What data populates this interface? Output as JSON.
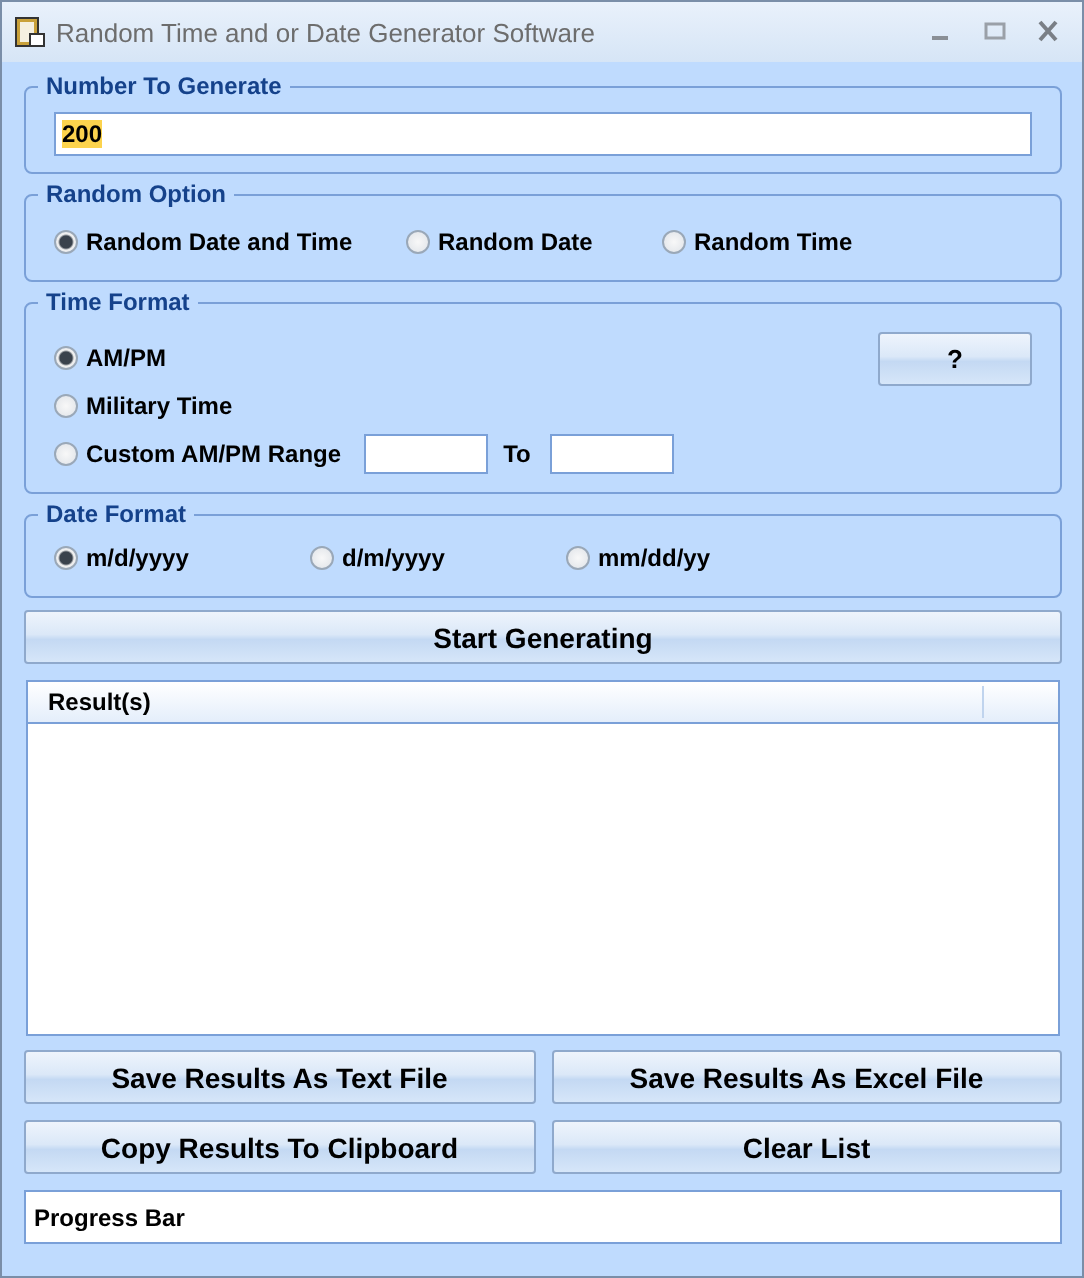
{
  "window": {
    "title": "Random Time and or Date Generator Software"
  },
  "number_group": {
    "title": "Number To Generate",
    "value": "200"
  },
  "random_option": {
    "title": "Random Option",
    "options": [
      {
        "label": "Random Date and Time",
        "selected": true
      },
      {
        "label": "Random Date",
        "selected": false
      },
      {
        "label": "Random Time",
        "selected": false
      }
    ]
  },
  "time_format": {
    "title": "Time Format",
    "help_button": "?",
    "options": [
      {
        "label": "AM/PM",
        "selected": true
      },
      {
        "label": "Military Time",
        "selected": false
      },
      {
        "label": "Custom AM/PM Range",
        "selected": false
      }
    ],
    "range_to": "To"
  },
  "date_format": {
    "title": "Date Format",
    "options": [
      {
        "label": "m/d/yyyy",
        "selected": true
      },
      {
        "label": "d/m/yyyy",
        "selected": false
      },
      {
        "label": "mm/dd/yy",
        "selected": false
      }
    ]
  },
  "start_button": "Start Generating",
  "results": {
    "columns": [
      "Result(s)"
    ]
  },
  "buttons": [
    "Save Results As Text File",
    "Save Results As Excel File",
    "Copy Results To Clipboard",
    "Clear List"
  ],
  "progress": {
    "label": "Progress Bar"
  }
}
